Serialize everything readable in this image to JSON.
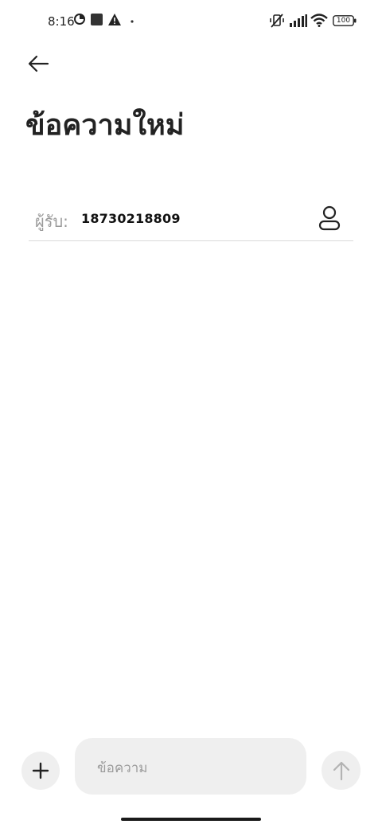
{
  "status_bar": {
    "time": "8:16",
    "battery": "100",
    "icons": [
      "data-saver-icon",
      "square-notification-icon",
      "warning-icon",
      "dot-icon",
      "vibrate-off-icon",
      "signal-icon",
      "wifi-icon",
      "battery-icon"
    ]
  },
  "header": {
    "back_icon": "arrow-left-icon",
    "title": "ข้อความใหม่"
  },
  "recipient": {
    "label": "ผู้รับ:",
    "value": "18730218809",
    "contact_icon": "person-icon"
  },
  "composer": {
    "add_icon": "plus-icon",
    "placeholder": "ข้อความ",
    "send_icon": "arrow-up-icon"
  },
  "colors": {
    "background": "#ffffff",
    "field_background": "#efefef",
    "muted_text": "#9a9a9a",
    "primary_text": "#222222"
  }
}
